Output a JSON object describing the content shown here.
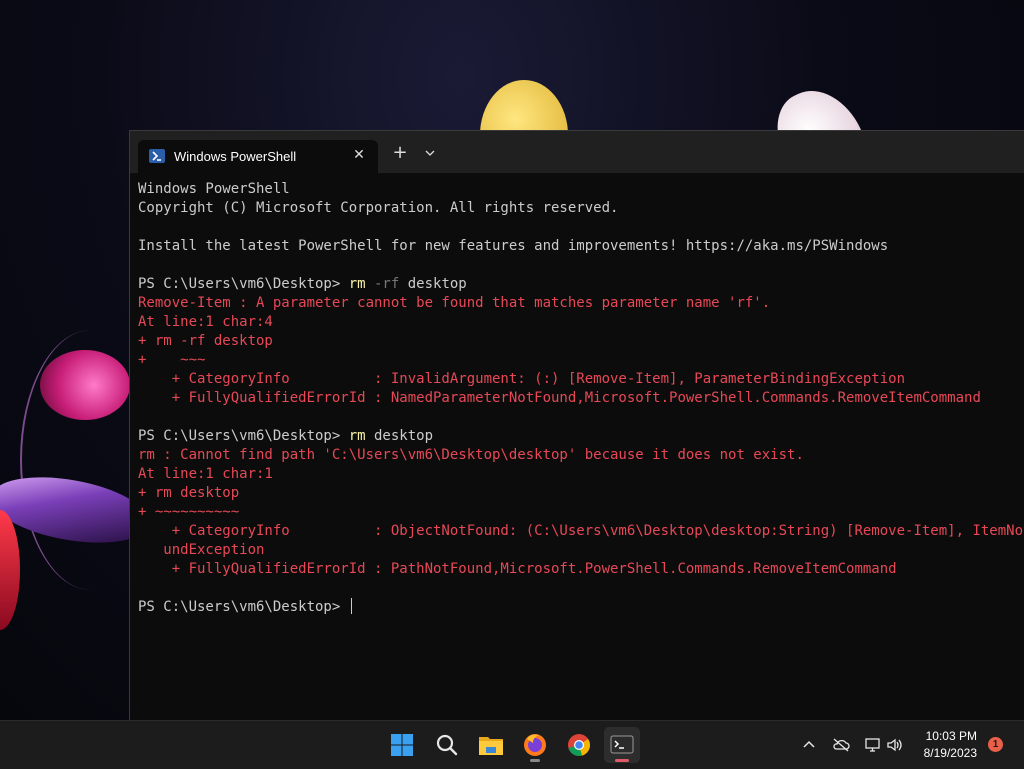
{
  "window": {
    "tab_title": "Windows PowerShell",
    "tab_icon": "powershell-icon",
    "new_tab_icon": "plus-icon",
    "dropdown_icon": "chevron-down-icon",
    "close_icon": "close-icon"
  },
  "console": {
    "lines": [
      {
        "t": "Windows PowerShell",
        "c": "w"
      },
      {
        "t": "Copyright (C) Microsoft Corporation. All rights reserved.",
        "c": "w"
      },
      {
        "t": "",
        "c": "w"
      },
      {
        "t": "Install the latest PowerShell for new features and improvements! https://aka.ms/PSWindows",
        "c": "w"
      },
      {
        "t": "",
        "c": "w"
      },
      {
        "prompt": "PS C:\\Users\\vm6\\Desktop> ",
        "cmd": "rm",
        "param": " -rf",
        "rest": " desktop"
      },
      {
        "t": "Remove-Item : A parameter cannot be found that matches parameter name 'rf'.",
        "c": "r"
      },
      {
        "t": "At line:1 char:4",
        "c": "r"
      },
      {
        "t": "+ rm -rf desktop",
        "c": "r"
      },
      {
        "t": "+    ~~~",
        "c": "r"
      },
      {
        "t": "    + CategoryInfo          : InvalidArgument: (:) [Remove-Item], ParameterBindingException",
        "c": "r"
      },
      {
        "t": "    + FullyQualifiedErrorId : NamedParameterNotFound,Microsoft.PowerShell.Commands.RemoveItemCommand",
        "c": "r"
      },
      {
        "t": "",
        "c": "w"
      },
      {
        "prompt": "PS C:\\Users\\vm6\\Desktop> ",
        "cmd": "rm",
        "param": "",
        "rest": " desktop"
      },
      {
        "t": "rm : Cannot find path 'C:\\Users\\vm6\\Desktop\\desktop' because it does not exist.",
        "c": "r"
      },
      {
        "t": "At line:1 char:1",
        "c": "r"
      },
      {
        "t": "+ rm desktop",
        "c": "r"
      },
      {
        "t": "+ ~~~~~~~~~~",
        "c": "r"
      },
      {
        "t": "    + CategoryInfo          : ObjectNotFound: (C:\\Users\\vm6\\Desktop\\desktop:String) [Remove-Item], ItemNotFo",
        "c": "r"
      },
      {
        "t": "   undException",
        "c": "r"
      },
      {
        "t": "    + FullyQualifiedErrorId : PathNotFound,Microsoft.PowerShell.Commands.RemoveItemCommand",
        "c": "r"
      },
      {
        "t": "",
        "c": "w"
      },
      {
        "prompt": "PS C:\\Users\\vm6\\Desktop> ",
        "cmd": "",
        "param": "",
        "rest": "",
        "cursor": true
      }
    ]
  },
  "colors": {
    "output": "#cccccc",
    "error": "#e74856",
    "command": "#f9f1a5",
    "parameter": "#767676",
    "terminal_bg": "#0c0c0c"
  },
  "taskbar": {
    "apps": [
      {
        "name": "start",
        "icon": "windows-logo-icon",
        "active": false,
        "running": false
      },
      {
        "name": "search",
        "icon": "search-icon",
        "active": false,
        "running": false
      },
      {
        "name": "file-explorer",
        "icon": "folder-icon",
        "active": false,
        "running": false
      },
      {
        "name": "firefox",
        "icon": "firefox-icon",
        "active": false,
        "running": true
      },
      {
        "name": "chrome",
        "icon": "chrome-icon",
        "active": false,
        "running": false
      },
      {
        "name": "terminal",
        "icon": "terminal-icon",
        "active": true,
        "running": true
      }
    ],
    "tray": {
      "icons": [
        "chevron-up-icon",
        "cloud-off-icon",
        "network-icon",
        "speaker-icon"
      ],
      "time": "10:03 PM",
      "date": "8/19/2023",
      "notification_count": "1"
    }
  }
}
